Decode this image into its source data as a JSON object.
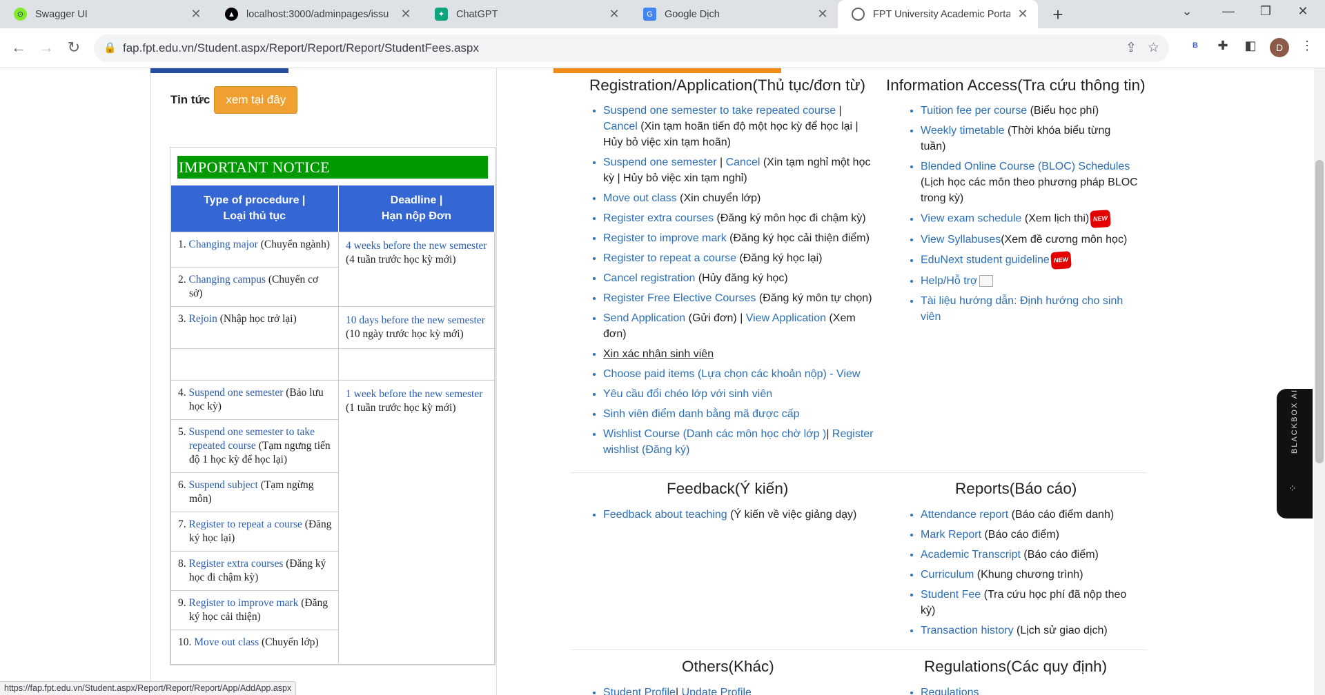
{
  "browser": {
    "tabs": [
      {
        "title": "Swagger UI",
        "icon": "swagger-icon",
        "color": "#85ea2d"
      },
      {
        "title": "localhost:3000/adminpages/issu",
        "icon": "triangle-icon",
        "color": "#000000"
      },
      {
        "title": "ChatGPT",
        "icon": "chatgpt-icon",
        "color": "#10a37f"
      },
      {
        "title": "Google Dịch",
        "icon": "google-translate-icon",
        "color": "#4285f4"
      },
      {
        "title": "FPT University Academic Portal",
        "icon": "globe-icon",
        "color": "#5f6368"
      }
    ],
    "url": "fap.fpt.edu.vn/Student.aspx/Report/Report/Report/StudentFees.aspx",
    "avatar_letter": "D",
    "status_url": "https://fap.fpt.edu.vn/Student.aspx/Report/Report/Report/App/AddApp.aspx"
  },
  "left": {
    "news_label": "Tin tức",
    "news_button": "xem tại đây",
    "notice_title": "IMPORTANT  NOTICE",
    "headers": {
      "type": [
        "Type of procedure |",
        "Loại thủ tục"
      ],
      "deadline": [
        "Deadline |",
        "Hạn nộp Đơn"
      ]
    },
    "groups": [
      {
        "items": [
          {
            "num": "1.",
            "link": "Changing major",
            "vn": " (Chuyển ngành)"
          },
          {
            "num": "2.",
            "link": "Changing campus",
            "vn": " (Chuyển cơ sở)"
          }
        ],
        "deadline_link": "4 weeks before the new semester",
        "deadline_vn": " (4 tuần  trước học kỳ mới)"
      },
      {
        "items": [
          {
            "num": "3.",
            "link": "Rejoin",
            "vn": " (Nhập học trở lại)"
          }
        ],
        "deadline_link": "10 days before the new semester",
        "deadline_vn": " (10 ngày trước học kỳ mới)"
      },
      {
        "items": [
          {
            "num": "4.",
            "link": "Suspend one semester",
            "vn": " (Bảo lưu học kỳ)"
          },
          {
            "num": "5.",
            "link": "Suspend one semester to take repeated course",
            "vn": " (Tạm ngưng tiến độ 1 học kỳ để học lại)"
          },
          {
            "num": "6.",
            "link": "Suspend subject",
            "vn": " (Tạm ngừng môn)"
          },
          {
            "num": "7.",
            "link": "Register to repeat a course",
            "vn": " (Đăng ký học lại)"
          },
          {
            "num": "8.",
            "link": "Register extra courses",
            "vn": " (Đăng ký học đi chậm kỳ)"
          },
          {
            "num": "9.",
            "link": "Register to improve mark",
            "vn": " (Đăng ký học cải thiện)"
          },
          {
            "num": "10.",
            "link": "Move out class",
            "vn": " (Chuyển lớp)"
          }
        ],
        "deadline_link": "1 week before the new semester",
        "deadline_vn": " (1 tuần trước học kỳ mới)"
      }
    ]
  },
  "right": {
    "registration": {
      "title": "Registration/Application(Thủ tục/đơn từ)",
      "items": [
        {
          "parts": [
            [
              "Suspend one semester to take repeated course",
              true
            ],
            [
              " | ",
              false
            ],
            [
              "Cancel",
              true
            ],
            [
              " (Xin tạm hoãn tiến độ một học kỳ để học lại | Hủy bỏ việc xin tạm hoãn)",
              false
            ]
          ]
        },
        {
          "parts": [
            [
              "Suspend one semester",
              true
            ],
            [
              " |  ",
              false
            ],
            [
              "Cancel",
              true
            ],
            [
              " (Xin tạm nghỉ một học kỳ | Hủy bỏ việc xin tạm nghỉ)",
              false
            ]
          ]
        },
        {
          "parts": [
            [
              "Move out class",
              true
            ],
            [
              " (Xin chuyển lớp)",
              false
            ]
          ]
        },
        {
          "parts": [
            [
              "Register extra courses",
              true
            ],
            [
              " (Đăng ký môn học đi chậm kỳ)",
              false
            ]
          ]
        },
        {
          "parts": [
            [
              "Register to improve mark",
              true
            ],
            [
              "  (Đăng ký học cải thiện điểm)",
              false
            ]
          ]
        },
        {
          "parts": [
            [
              "Register to repeat a course",
              true
            ],
            [
              " (Đăng ký học lại)",
              false
            ]
          ]
        },
        {
          "parts": [
            [
              "Cancel registration",
              true
            ],
            [
              " (Hủy đăng ký học)",
              false
            ]
          ]
        },
        {
          "parts": [
            [
              "Register Free Elective Courses",
              true
            ],
            [
              " (Đăng ký môn tự chọn)",
              false
            ]
          ]
        },
        {
          "parts": [
            [
              "Send Application",
              true
            ],
            [
              " (Gửi đơn) |  ",
              false
            ],
            [
              "View Application",
              true
            ],
            [
              " (Xem đơn)",
              false
            ]
          ]
        },
        {
          "parts": [
            [
              "Xin xác nhận sinh viên",
              "u"
            ]
          ]
        },
        {
          "parts": [
            [
              "Choose paid items (Lựa chọn các khoản nộp) - View",
              true
            ]
          ]
        },
        {
          "parts": [
            [
              "Yêu cầu đổi chéo lớp với sinh viên",
              true
            ]
          ]
        },
        {
          "parts": [
            [
              "Sinh viên điểm danh bằng mã được cấp",
              true
            ]
          ]
        },
        {
          "parts": [
            [
              "Wishlist Course (Danh các môn học chờ lớp )",
              true
            ],
            [
              "| ",
              false
            ],
            [
              "Register wishlist (Đăng ký)",
              true
            ]
          ]
        }
      ]
    },
    "information": {
      "title": "Information Access(Tra cứu thông tin)",
      "items": [
        {
          "parts": [
            [
              "Tuition fee per course",
              true
            ],
            [
              " (Biểu học phí)",
              false
            ]
          ]
        },
        {
          "parts": [
            [
              "Weekly timetable",
              true
            ],
            [
              " (Thời khóa biểu từng tuần)",
              false
            ]
          ]
        },
        {
          "parts": [
            [
              "Blended Online Course (BLOC) Schedules",
              true
            ],
            [
              " (Lịch học các môn theo phương pháp BLOC trong kỳ)",
              false
            ]
          ]
        },
        {
          "parts": [
            [
              "View exam schedule",
              true
            ],
            [
              " (Xem lịch thi)",
              false
            ]
          ],
          "badge": "NEW"
        },
        {
          "parts": [
            [
              "View Syllabuses",
              true
            ],
            [
              "(Xem đề cương môn học)",
              false
            ]
          ]
        },
        {
          "parts": [
            [
              "EduNext student guideline",
              true
            ]
          ],
          "badge": "NEW"
        },
        {
          "parts": [
            [
              "Help/Hỗ trợ",
              true
            ]
          ],
          "broken_img": true
        },
        {
          "parts": [
            [
              "Tài liệu hướng dẫn: Định hướng cho sinh viên",
              true
            ]
          ]
        }
      ]
    },
    "feedback": {
      "title": "Feedback(Ý kiến)",
      "items": [
        {
          "parts": [
            [
              "Feedback about teaching",
              true
            ],
            [
              " (Ý kiến về việc giảng dạy)",
              false
            ]
          ]
        }
      ]
    },
    "reports": {
      "title": "Reports(Báo cáo)",
      "items": [
        {
          "parts": [
            [
              "Attendance report",
              true
            ],
            [
              " (Báo cáo điểm danh)",
              false
            ]
          ]
        },
        {
          "parts": [
            [
              "Mark Report",
              true
            ],
            [
              " (Báo cáo điểm)",
              false
            ]
          ]
        },
        {
          "parts": [
            [
              "Academic Transcript",
              true
            ],
            [
              " (Báo cáo điểm)",
              false
            ]
          ]
        },
        {
          "parts": [
            [
              "Curriculum",
              true
            ],
            [
              " (Khung chương trình)",
              false
            ]
          ]
        },
        {
          "parts": [
            [
              "Student Fee",
              true
            ],
            [
              " (Tra cứu học phí đã nộp theo kỳ)",
              false
            ]
          ]
        },
        {
          "parts": [
            [
              "Transaction history",
              true
            ],
            [
              " (Lịch sử giao dịch)",
              false
            ]
          ]
        }
      ]
    },
    "others": {
      "title": "Others(Khác)",
      "items": [
        {
          "parts": [
            [
              "Student Profile",
              true
            ],
            [
              "| ",
              false
            ],
            [
              "Update Profile",
              true
            ]
          ]
        }
      ]
    },
    "regulations": {
      "title": "Regulations(Các quy định)",
      "items": [
        {
          "parts": [
            [
              "Regulations",
              true
            ]
          ]
        }
      ]
    }
  },
  "blackbox": {
    "label": "BLACKBOX AI"
  }
}
